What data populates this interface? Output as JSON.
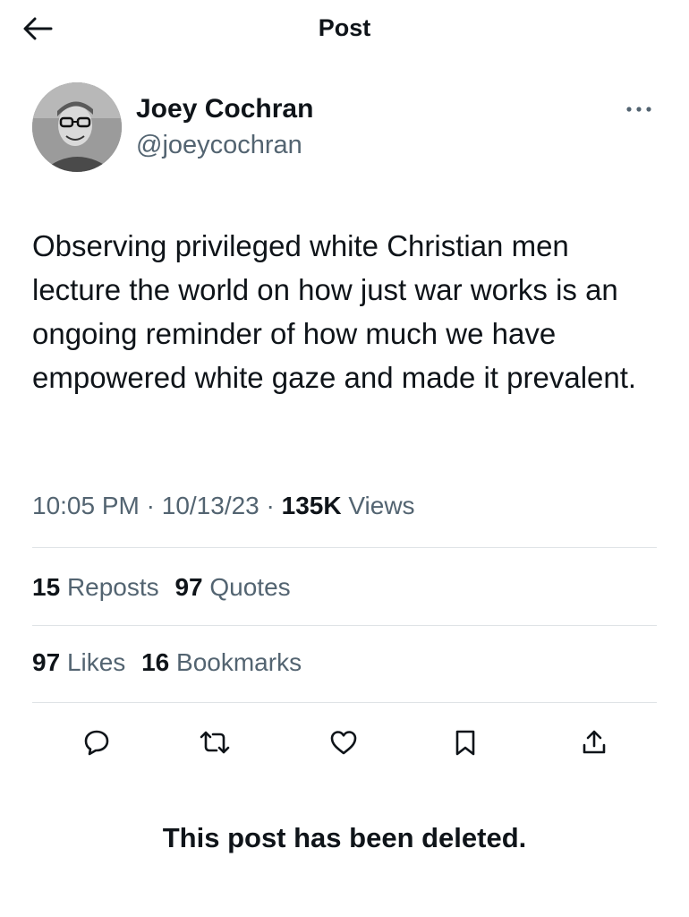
{
  "header": {
    "title": "Post",
    "back_icon": "arrow-left-icon"
  },
  "author": {
    "name": "Joey Cochran",
    "handle": "@joeycochran",
    "more_icon": "more-horizontal-icon"
  },
  "post": {
    "text": "Observing privileged white Christian men lecture the world on how just war works is an ongoing reminder of how much we have empowered white gaze and made it prevalent."
  },
  "meta": {
    "time": "10:05 PM",
    "separator": "·",
    "date": "10/13/23",
    "views_count": "135K",
    "views_label": "Views"
  },
  "stats": {
    "reposts_count": "15",
    "reposts_label": "Reposts",
    "quotes_count": "97",
    "quotes_label": "Quotes",
    "likes_count": "97",
    "likes_label": "Likes",
    "bookmarks_count": "16",
    "bookmarks_label": "Bookmarks"
  },
  "actions": [
    {
      "icon": "reply-icon"
    },
    {
      "icon": "repost-icon"
    },
    {
      "icon": "like-icon"
    },
    {
      "icon": "bookmark-icon"
    },
    {
      "icon": "share-icon"
    }
  ],
  "notice": "This post has been deleted.",
  "colors": {
    "text_primary": "#0f1419",
    "text_secondary": "#536471",
    "divider": "#dfe3e6",
    "background": "#ffffff"
  }
}
